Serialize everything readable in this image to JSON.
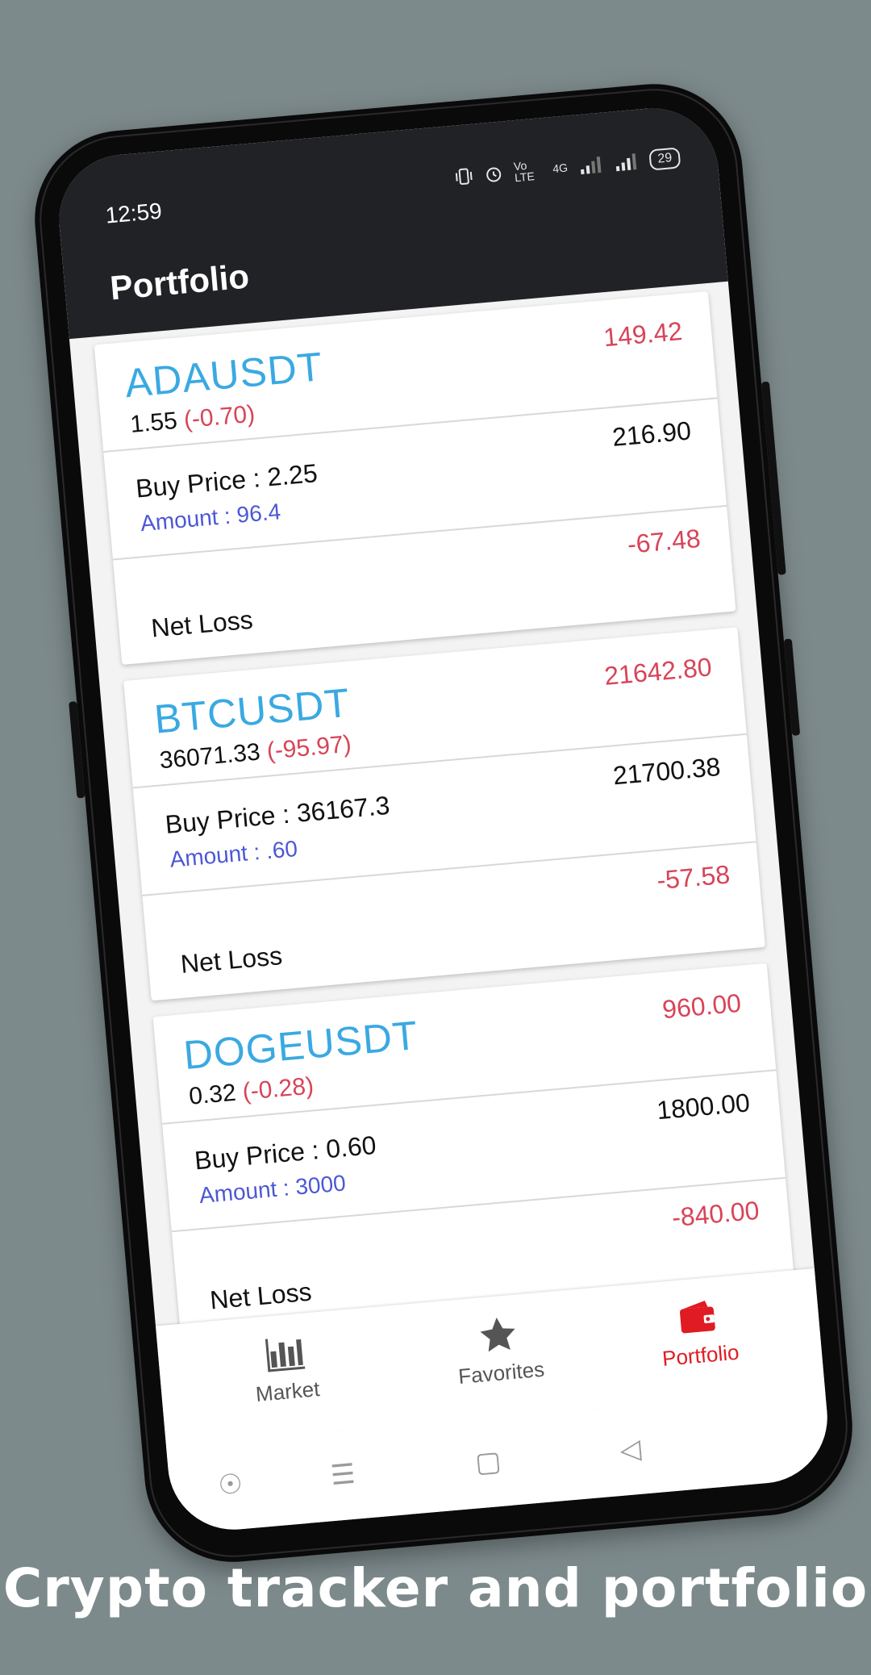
{
  "status_bar": {
    "time": "12:59",
    "network_label": "Vo LTE",
    "signal_label": "4G",
    "battery": "29"
  },
  "app": {
    "title": "Portfolio"
  },
  "colors": {
    "symbol": "#3aa9e2",
    "loss": "#d84458",
    "amount": "#4c57d6",
    "active_tab": "#e01b23",
    "appbar": "#212225"
  },
  "cards": [
    {
      "symbol": "ADAUSDT",
      "price": "1.55",
      "change": "(-0.70)",
      "top_value": "149.42",
      "buy_price": "Buy Price : 2.25",
      "amount": "Amount : 96.4",
      "current_value": "216.90",
      "net_label": "Net Loss",
      "net_value": "-67.48"
    },
    {
      "symbol": "BTCUSDT",
      "price": "36071.33",
      "change": "(-95.97)",
      "top_value": "21642.80",
      "buy_price": "Buy Price : 36167.3",
      "amount": "Amount : .60",
      "current_value": "21700.38",
      "net_label": "Net Loss",
      "net_value": "-57.58"
    },
    {
      "symbol": "DOGEUSDT",
      "price": "0.32",
      "change": "(-0.28)",
      "top_value": "960.00",
      "buy_price": "Buy Price : 0.60",
      "amount": "Amount : 3000",
      "current_value": "1800.00",
      "net_label": "Net Loss",
      "net_value": "-840.00"
    }
  ],
  "bottom_nav": {
    "items": [
      {
        "label": "Market",
        "icon": "bar-chart-icon",
        "active": false
      },
      {
        "label": "Favorites",
        "icon": "star-icon",
        "active": false
      },
      {
        "label": "Portfolio",
        "icon": "wallet-icon",
        "active": true
      }
    ]
  },
  "caption": "Crypto tracker and portfolio"
}
